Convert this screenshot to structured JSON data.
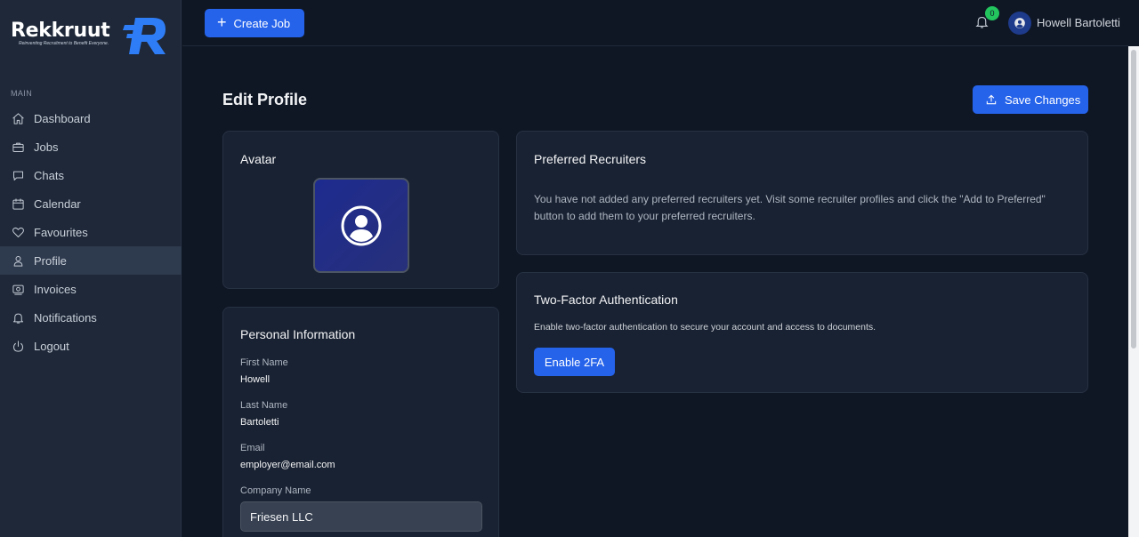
{
  "brand": {
    "name": "Rekkruut",
    "tagline": "Reinventing Recruitment to Benefit Everyone."
  },
  "sidebar": {
    "section_label": "MAIN",
    "items": [
      {
        "label": "Dashboard",
        "icon": "home-icon"
      },
      {
        "label": "Jobs",
        "icon": "briefcase-icon"
      },
      {
        "label": "Chats",
        "icon": "chat-icon"
      },
      {
        "label": "Calendar",
        "icon": "calendar-icon"
      },
      {
        "label": "Favourites",
        "icon": "heart-icon"
      },
      {
        "label": "Profile",
        "icon": "user-icon",
        "active": true
      },
      {
        "label": "Invoices",
        "icon": "invoice-icon"
      },
      {
        "label": "Notifications",
        "icon": "bell-icon"
      },
      {
        "label": "Logout",
        "icon": "logout-icon"
      }
    ]
  },
  "topbar": {
    "create_job_label": "Create Job",
    "notification_count": "0",
    "user_name": "Howell Bartoletti"
  },
  "page": {
    "title": "Edit Profile",
    "save_label": "Save Changes"
  },
  "avatar_card": {
    "title": "Avatar"
  },
  "personal_info": {
    "title": "Personal Information",
    "first_name_label": "First Name",
    "first_name": "Howell",
    "last_name_label": "Last Name",
    "last_name": "Bartoletti",
    "email_label": "Email",
    "email": "employer@email.com",
    "company_label": "Company Name",
    "company": "Friesen LLC"
  },
  "preferred": {
    "title": "Preferred Recruiters",
    "text": "You have not added any preferred recruiters yet. Visit some recruiter profiles and click the \"Add to Preferred\" button to add them to your preferred recruiters."
  },
  "twofa": {
    "title": "Two-Factor Authentication",
    "description": "Enable two-factor authentication to secure your account and access to documents.",
    "button_label": "Enable 2FA"
  },
  "colors": {
    "accent": "#2563eb",
    "background": "#0f1725",
    "sidebar": "#1e2838",
    "card": "#192232",
    "badge": "#22c55e"
  }
}
